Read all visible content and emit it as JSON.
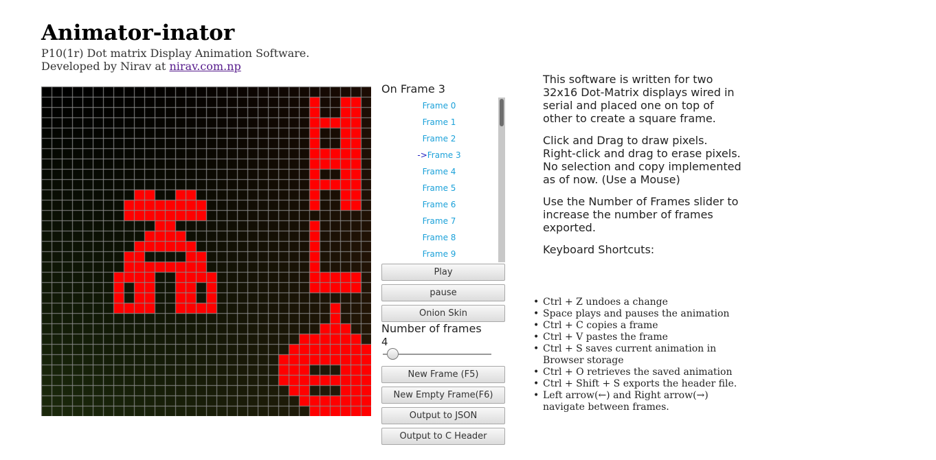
{
  "header": {
    "title": "Animator-inator",
    "subtitle": "P10(1r) Dot matrix Display Animation Software.",
    "developer_prefix": "Developed by Nirav at ",
    "developer_link": "nirav.com.np"
  },
  "canvas": {
    "rows": 32,
    "cols": 32,
    "on_color": "#ff0000",
    "grid_color": "#8a8a8a",
    "bg_top_color": "#000000",
    "bg_bottom_left_color": "#1c2a0c",
    "bg_right_color": "#2a1206",
    "lit_pixels": [
      [
        1,
        26
      ],
      [
        1,
        29
      ],
      [
        1,
        30
      ],
      [
        2,
        26
      ],
      [
        2,
        29
      ],
      [
        2,
        30
      ],
      [
        3,
        26
      ],
      [
        3,
        27
      ],
      [
        3,
        28
      ],
      [
        3,
        29
      ],
      [
        3,
        30
      ],
      [
        4,
        26
      ],
      [
        4,
        29
      ],
      [
        4,
        30
      ],
      [
        5,
        26
      ],
      [
        5,
        29
      ],
      [
        5,
        30
      ],
      [
        6,
        26
      ],
      [
        6,
        27
      ],
      [
        6,
        28
      ],
      [
        6,
        29
      ],
      [
        6,
        30
      ],
      [
        7,
        26
      ],
      [
        7,
        27
      ],
      [
        7,
        28
      ],
      [
        7,
        29
      ],
      [
        7,
        30
      ],
      [
        8,
        26
      ],
      [
        8,
        29
      ],
      [
        8,
        30
      ],
      [
        9,
        26
      ],
      [
        9,
        27
      ],
      [
        9,
        28
      ],
      [
        9,
        29
      ],
      [
        9,
        30
      ],
      [
        10,
        26
      ],
      [
        10,
        29
      ],
      [
        10,
        30
      ],
      [
        11,
        26
      ],
      [
        11,
        29
      ],
      [
        11,
        30
      ],
      [
        10,
        9
      ],
      [
        10,
        10
      ],
      [
        10,
        13
      ],
      [
        10,
        14
      ],
      [
        11,
        8
      ],
      [
        11,
        9
      ],
      [
        11,
        10
      ],
      [
        11,
        11
      ],
      [
        11,
        12
      ],
      [
        11,
        13
      ],
      [
        11,
        14
      ],
      [
        11,
        15
      ],
      [
        11,
        26
      ],
      [
        12,
        8
      ],
      [
        12,
        9
      ],
      [
        12,
        10
      ],
      [
        12,
        11
      ],
      [
        12,
        12
      ],
      [
        12,
        13
      ],
      [
        12,
        14
      ],
      [
        12,
        15
      ],
      [
        13,
        11
      ],
      [
        13,
        12
      ],
      [
        13,
        26
      ],
      [
        14,
        10
      ],
      [
        14,
        11
      ],
      [
        14,
        12
      ],
      [
        14,
        13
      ],
      [
        14,
        26
      ],
      [
        15,
        9
      ],
      [
        15,
        10
      ],
      [
        15,
        11
      ],
      [
        15,
        12
      ],
      [
        15,
        13
      ],
      [
        15,
        14
      ],
      [
        15,
        26
      ],
      [
        16,
        8
      ],
      [
        16,
        9
      ],
      [
        16,
        14
      ],
      [
        16,
        15
      ],
      [
        16,
        26
      ],
      [
        17,
        8
      ],
      [
        17,
        9
      ],
      [
        17,
        10
      ],
      [
        17,
        11
      ],
      [
        17,
        12
      ],
      [
        17,
        13
      ],
      [
        17,
        14
      ],
      [
        17,
        15
      ],
      [
        17,
        26
      ],
      [
        18,
        7
      ],
      [
        18,
        8
      ],
      [
        18,
        9
      ],
      [
        18,
        10
      ],
      [
        18,
        13
      ],
      [
        18,
        14
      ],
      [
        18,
        15
      ],
      [
        18,
        16
      ],
      [
        18,
        26
      ],
      [
        18,
        27
      ],
      [
        18,
        28
      ],
      [
        18,
        29
      ],
      [
        18,
        30
      ],
      [
        19,
        7
      ],
      [
        19,
        9
      ],
      [
        19,
        10
      ],
      [
        19,
        13
      ],
      [
        19,
        14
      ],
      [
        19,
        16
      ],
      [
        19,
        26
      ],
      [
        19,
        27
      ],
      [
        19,
        28
      ],
      [
        19,
        29
      ],
      [
        19,
        30
      ],
      [
        20,
        7
      ],
      [
        20,
        9
      ],
      [
        20,
        10
      ],
      [
        20,
        13
      ],
      [
        20,
        14
      ],
      [
        20,
        16
      ],
      [
        21,
        7
      ],
      [
        21,
        8
      ],
      [
        21,
        9
      ],
      [
        21,
        10
      ],
      [
        21,
        13
      ],
      [
        21,
        14
      ],
      [
        21,
        15
      ],
      [
        21,
        16
      ],
      [
        21,
        28
      ],
      [
        22,
        28
      ],
      [
        23,
        27
      ],
      [
        23,
        28
      ],
      [
        23,
        29
      ],
      [
        24,
        25
      ],
      [
        24,
        26
      ],
      [
        24,
        27
      ],
      [
        24,
        28
      ],
      [
        24,
        29
      ],
      [
        24,
        30
      ],
      [
        25,
        24
      ],
      [
        25,
        25
      ],
      [
        25,
        26
      ],
      [
        25,
        27
      ],
      [
        25,
        28
      ],
      [
        25,
        29
      ],
      [
        25,
        30
      ],
      [
        25,
        31
      ],
      [
        26,
        23
      ],
      [
        26,
        24
      ],
      [
        26,
        25
      ],
      [
        26,
        26
      ],
      [
        26,
        27
      ],
      [
        26,
        28
      ],
      [
        26,
        29
      ],
      [
        26,
        30
      ],
      [
        26,
        31
      ],
      [
        27,
        23
      ],
      [
        27,
        24
      ],
      [
        27,
        25
      ],
      [
        27,
        29
      ],
      [
        27,
        30
      ],
      [
        27,
        31
      ],
      [
        28,
        23
      ],
      [
        28,
        24
      ],
      [
        28,
        25
      ],
      [
        28,
        26
      ],
      [
        28,
        27
      ],
      [
        28,
        28
      ],
      [
        28,
        29
      ],
      [
        28,
        30
      ],
      [
        28,
        31
      ],
      [
        29,
        24
      ],
      [
        29,
        25
      ],
      [
        29,
        29
      ],
      [
        29,
        30
      ],
      [
        29,
        31
      ],
      [
        30,
        25
      ],
      [
        30,
        26
      ],
      [
        30,
        27
      ],
      [
        30,
        28
      ],
      [
        30,
        29
      ],
      [
        30,
        30
      ],
      [
        30,
        31
      ],
      [
        31,
        26
      ],
      [
        31,
        27
      ],
      [
        31,
        28
      ],
      [
        31,
        29
      ],
      [
        31,
        30
      ],
      [
        31,
        31
      ]
    ]
  },
  "frames": {
    "status": "On Frame 3",
    "current_marker": "->",
    "current_index": 3,
    "items": [
      "Frame 0",
      "Frame 1",
      "Frame 2",
      "Frame 3",
      "Frame 4",
      "Frame 5",
      "Frame 6",
      "Frame 7",
      "Frame 8",
      "Frame 9"
    ]
  },
  "controls": {
    "play": "Play",
    "pause": "pause",
    "onion_skin": "Onion Skin",
    "number_of_frames_label": "Number of frames",
    "number_of_frames_value": "4",
    "slider_fraction": 0.04,
    "new_frame": "New Frame (F5)",
    "new_empty_frame": "New Empty Frame(F6)",
    "output_json": "Output to JSON",
    "output_c_header": "Output to C Header"
  },
  "info": {
    "p1": "This software is written for two 32x16 Dot-Matrix displays wired in serial and placed one on top of other to create a square frame.",
    "p2": "Click and Drag to draw pixels. Right-click and drag to erase pixels. No selection and copy implemented as of now. (Use a Mouse)",
    "p3": "Use the Number of Frames slider to increase the number of frames exported.",
    "p4": "Keyboard Shortcuts:",
    "shortcuts": [
      "Ctrl + Z undoes a change",
      "Space plays and pauses the animation",
      "Ctrl + C copies a frame",
      "Ctrl + V pastes the frame",
      "Ctrl + S saves current animation in Browser storage",
      "Ctrl + O retrieves the saved animation",
      "Ctrl + Shift + S exports the header file.",
      "Left arrow(←) and Right arrow(→) navigate between frames."
    ]
  }
}
